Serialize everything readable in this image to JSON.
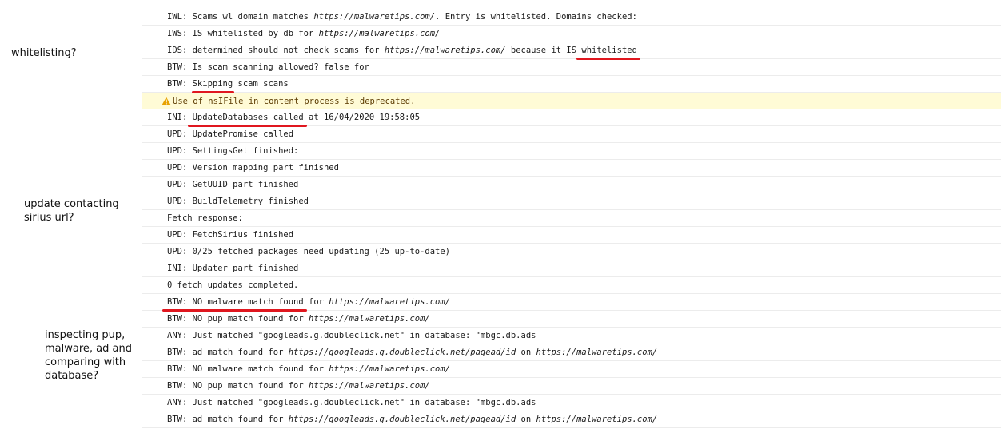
{
  "annotations": {
    "whitelisting": "whitelisting?",
    "update": [
      "update contacting",
      "sirius url?"
    ],
    "inspecting": [
      "inspecting pup,",
      "malware, ad and",
      "comparing with",
      "database?"
    ]
  },
  "console": {
    "rows": [
      {
        "pre": "IWL: Scams wl domain matches ",
        "url": "https://malwaretips.com/",
        "post": ". Entry is whitelisted. Domains checked:"
      },
      {
        "pre": "IWS: IS whitelisted by db for ",
        "url": "https://malwaretips.com/"
      },
      {
        "pre": "IDS: determined should not check scams for ",
        "url": "https://malwaretips.com/",
        "post": " because it IS ",
        "mark": "whitelisted"
      },
      {
        "pre": "BTW: Is scam scanning allowed? false for"
      },
      {
        "pre": "BTW: ",
        "mark": "Skipping",
        "post": " scam scans"
      },
      {
        "pre": "Use of nsIFile in content process is deprecated.",
        "warn": true
      },
      {
        "pre": "INI: ",
        "mark": "UpdateDatabases called",
        "post": " at 16/04/2020 19:58:05"
      },
      {
        "pre": "UPD: UpdatePromise called"
      },
      {
        "pre": "UPD: SettingsGet finished:"
      },
      {
        "pre": "UPD: Version mapping part finished"
      },
      {
        "pre": "UPD: GetUUID part finished"
      },
      {
        "pre": "UPD: BuildTelemetry finished"
      },
      {
        "pre": "Fetch response:"
      },
      {
        "pre": "UPD: FetchSirius finished"
      },
      {
        "pre": "UPD: 0/25 fetched packages need updating (25 up-to-date)"
      },
      {
        "pre": "INI: Updater part finished"
      },
      {
        "pre": "0 fetch updates completed."
      },
      {
        "pre": "",
        "mark": "BTW: NO malware match found",
        "post": " for ",
        "url2": "https://malwaretips.com/"
      },
      {
        "pre": "BTW: NO pup match found for ",
        "url": "https://malwaretips.com/"
      },
      {
        "pre": "ANY: Just matched \"googleads.g.doubleclick.net\" in database: \"mbgc.db.ads"
      },
      {
        "pre": "BTW: ad match found for ",
        "url": "https://googleads.g.doubleclick.net/pagead/id",
        "post": " on ",
        "url2": "https://malwaretips.com/"
      },
      {
        "pre": "BTW: NO malware match found for ",
        "url": "https://malwaretips.com/"
      },
      {
        "pre": "BTW: NO pup match found for ",
        "url": "https://malwaretips.com/"
      },
      {
        "pre": "ANY: Just matched \"googleads.g.doubleclick.net\" in database: \"mbgc.db.ads"
      },
      {
        "pre": "BTW: ad match found for ",
        "url": "https://googleads.g.doubleclick.net/pagead/id",
        "post": " on ",
        "url2": "https://malwaretips.com/"
      }
    ]
  },
  "colors": {
    "underline": "#e0171f",
    "warning_bg": "#fffbd6",
    "warning_icon": "#e8a200"
  },
  "icons": {
    "warning": "warning-triangle-icon"
  }
}
